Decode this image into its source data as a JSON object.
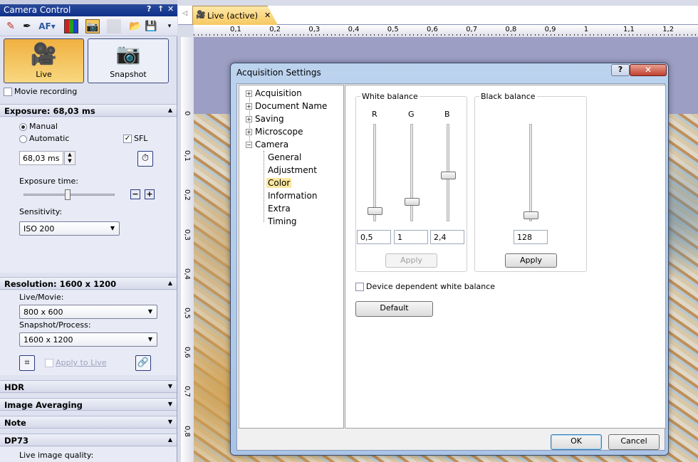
{
  "panel": {
    "title": "Camera Control",
    "title_controls": [
      "?",
      "↑",
      "✕"
    ],
    "toolbar": [
      "eyedropper-white-icon",
      "eyedropper-black-icon",
      "autofocus-icon",
      "color-icon",
      "camera-settings-icon",
      "disabled-icon",
      "open-folder-icon",
      "save-icon",
      "overflow-icon"
    ],
    "toolbar_af": "AF",
    "live_label": "Live",
    "snapshot_label": "Snapshot",
    "movie_recording": "Movie recording",
    "exposure": {
      "header": "Exposure: 68,03 ms",
      "manual": "Manual",
      "automatic": "Automatic",
      "sfl": "SFL",
      "sfl_checked": true,
      "value": "68,03 ms",
      "exposure_time_label": "Exposure time:",
      "exposure_slider_level": 0.5,
      "sensitivity_label": "Sensitivity:",
      "sensitivity": "ISO 200",
      "mode": "Manual"
    },
    "resolution": {
      "header": "Resolution: 1600 x 1200",
      "live_label": "Live/Movie:",
      "live_value": "800 x 600",
      "snapshot_label": "Snapshot/Process:",
      "snapshot_value": "1600 x 1200",
      "apply_to_live": "Apply to Live"
    },
    "sections": [
      "HDR",
      "Image Averaging",
      "Note",
      "DP73"
    ],
    "dp73_label": "Live image quality:"
  },
  "document": {
    "tab": "Live (active)",
    "tab_close": "✕",
    "hruler": [
      "0,1",
      "0,2",
      "0,3",
      "0,4",
      "0,5",
      "0,6",
      "0,7",
      "0,8",
      "0,9",
      "1",
      "1,1",
      "1,2"
    ],
    "vruler": [
      "0",
      "0,1",
      "0,2",
      "0,3",
      "0,4",
      "0,5",
      "0,6",
      "0,7",
      "0,8"
    ]
  },
  "dialog": {
    "title": "Acquisition Settings",
    "help": "?",
    "close": "✕",
    "tree": [
      {
        "label": "Acquisition",
        "expander": "+"
      },
      {
        "label": "Document Name",
        "expander": "+"
      },
      {
        "label": "Saving",
        "expander": "+"
      },
      {
        "label": "Microscope",
        "expander": "+"
      },
      {
        "label": "Camera",
        "expander": "−"
      }
    ],
    "camera_children": [
      "General",
      "Adjustment",
      "Color",
      "Information",
      "Extra",
      "Timing"
    ],
    "selected": "Color",
    "white_balance": {
      "label": "White balance",
      "channels": [
        {
          "name": "R",
          "value": "0,5",
          "level": 0.1
        },
        {
          "name": "G",
          "value": "1",
          "level": 0.2
        },
        {
          "name": "B",
          "value": "2,4",
          "level": 0.47
        }
      ],
      "apply": "Apply",
      "apply_enabled": false
    },
    "black_balance": {
      "label": "Black balance",
      "value": "128",
      "level": 0.06,
      "apply": "Apply"
    },
    "device_dependent": "Device dependent white balance",
    "device_dependent_checked": false,
    "default": "Default",
    "ok": "OK",
    "cancel": "Cancel"
  },
  "colors": {
    "accent": "#f6c860",
    "title_bar": "#10308a",
    "selection": "#fbe7a0"
  }
}
